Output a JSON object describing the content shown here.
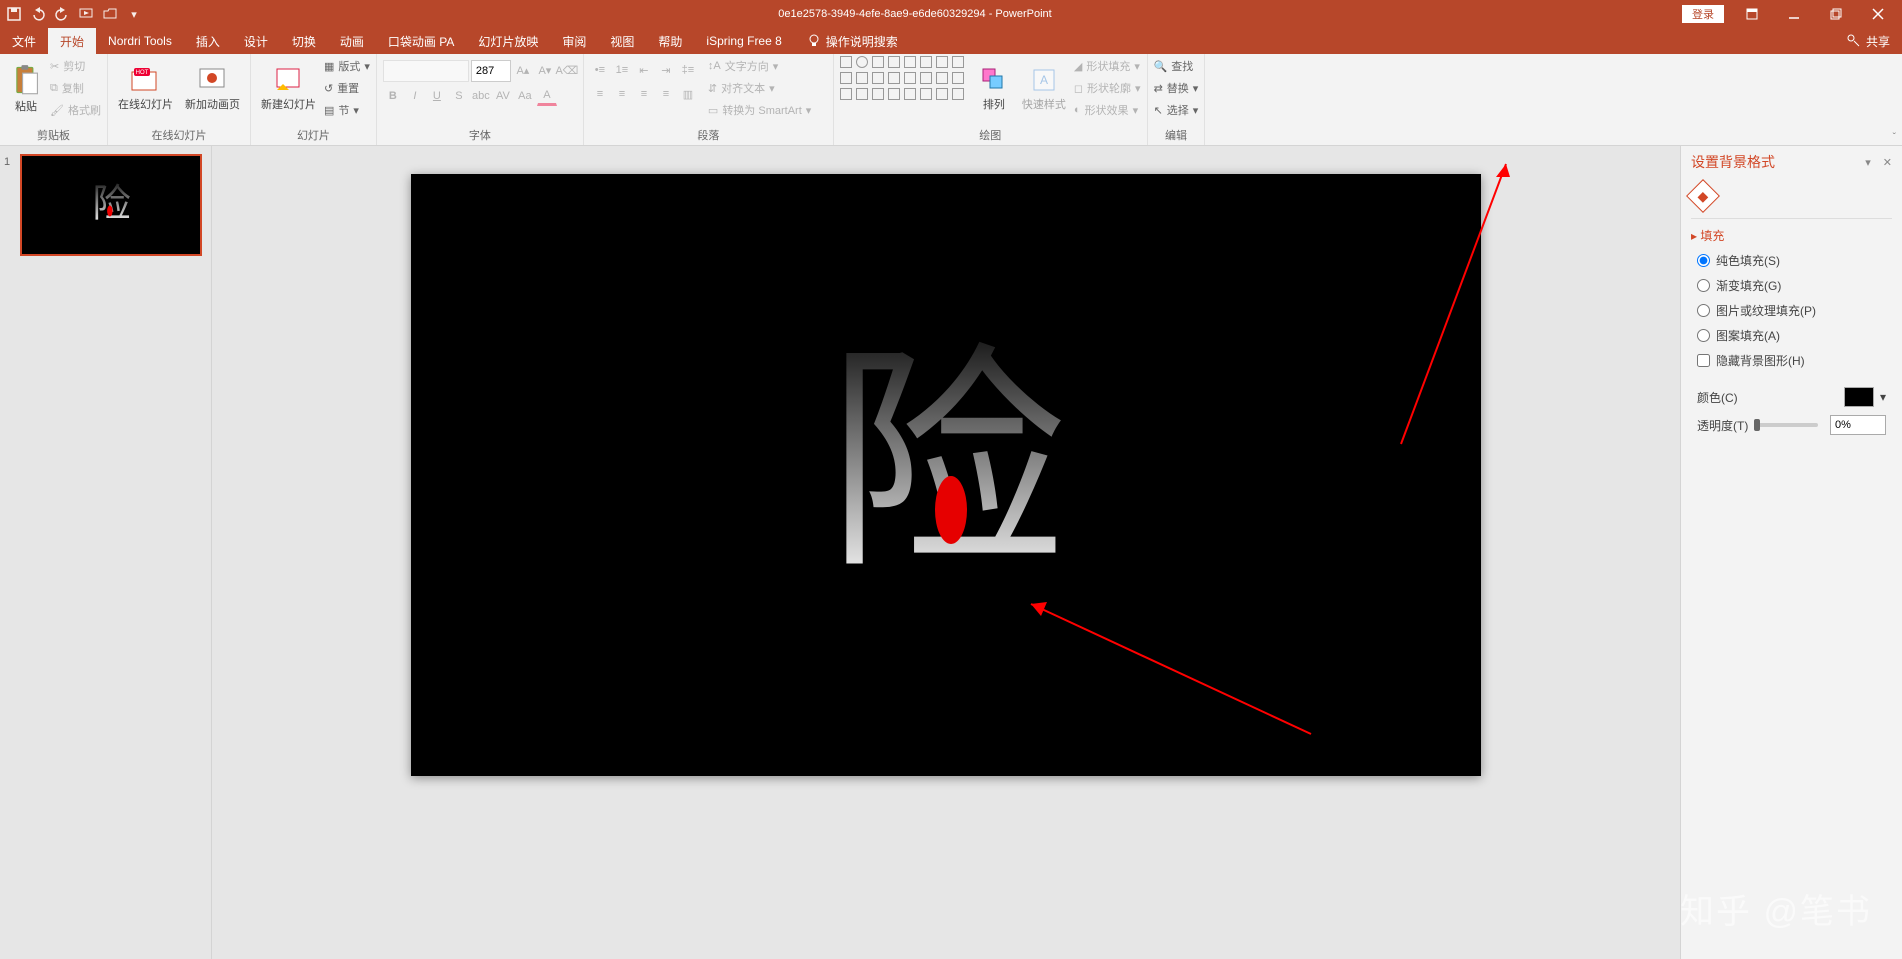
{
  "titlebar": {
    "doc_title": "0e1e2578-3949-4efe-8ae9-e6de60329294  -  PowerPoint",
    "login": "登录"
  },
  "menus": {
    "file": "文件",
    "home": "开始",
    "nordri": "Nordri Tools",
    "insert": "插入",
    "design": "设计",
    "transitions": "切换",
    "animations": "动画",
    "pocket": "口袋动画 PA",
    "slideshow": "幻灯片放映",
    "review": "审阅",
    "view": "视图",
    "help": "帮助",
    "ispring": "iSpring Free 8",
    "tellme": "操作说明搜索",
    "share": "共享"
  },
  "ribbon": {
    "clipboard": {
      "label": "剪贴板",
      "paste": "粘贴",
      "cut": "剪切",
      "copy": "复制",
      "format_painter": "格式刷"
    },
    "online_slides": {
      "label": "在线幻灯片",
      "online": "在线幻灯片",
      "new_anim": "新加动画页"
    },
    "slides": {
      "label": "幻灯片",
      "new_slide": "新建幻灯片",
      "layout": "版式",
      "reset": "重置",
      "section": "节"
    },
    "font": {
      "label": "字体",
      "size_value": "287"
    },
    "paragraph": {
      "label": "段落",
      "text_dir": "文字方向",
      "align": "对齐文本",
      "smartart": "转换为 SmartArt"
    },
    "drawing": {
      "label": "绘图",
      "arrange": "排列",
      "quick_styles": "快速样式",
      "shape_fill": "形状填充",
      "shape_outline": "形状轮廓",
      "shape_effects": "形状效果"
    },
    "editing": {
      "label": "编辑",
      "find": "查找",
      "replace": "替换",
      "select": "选择"
    }
  },
  "thumbs": {
    "num1": "1"
  },
  "pane": {
    "title": "设置背景格式",
    "section_fill": "填充",
    "opt_solid": "纯色填充(S)",
    "opt_gradient": "渐变填充(G)",
    "opt_picture": "图片或纹理填充(P)",
    "opt_pattern": "图案填充(A)",
    "chk_hide": "隐藏背景图形(H)",
    "lbl_color": "颜色(C)",
    "lbl_transparency": "透明度(T)",
    "transparency_value": "0%"
  },
  "watermark": "知乎 @笔书"
}
